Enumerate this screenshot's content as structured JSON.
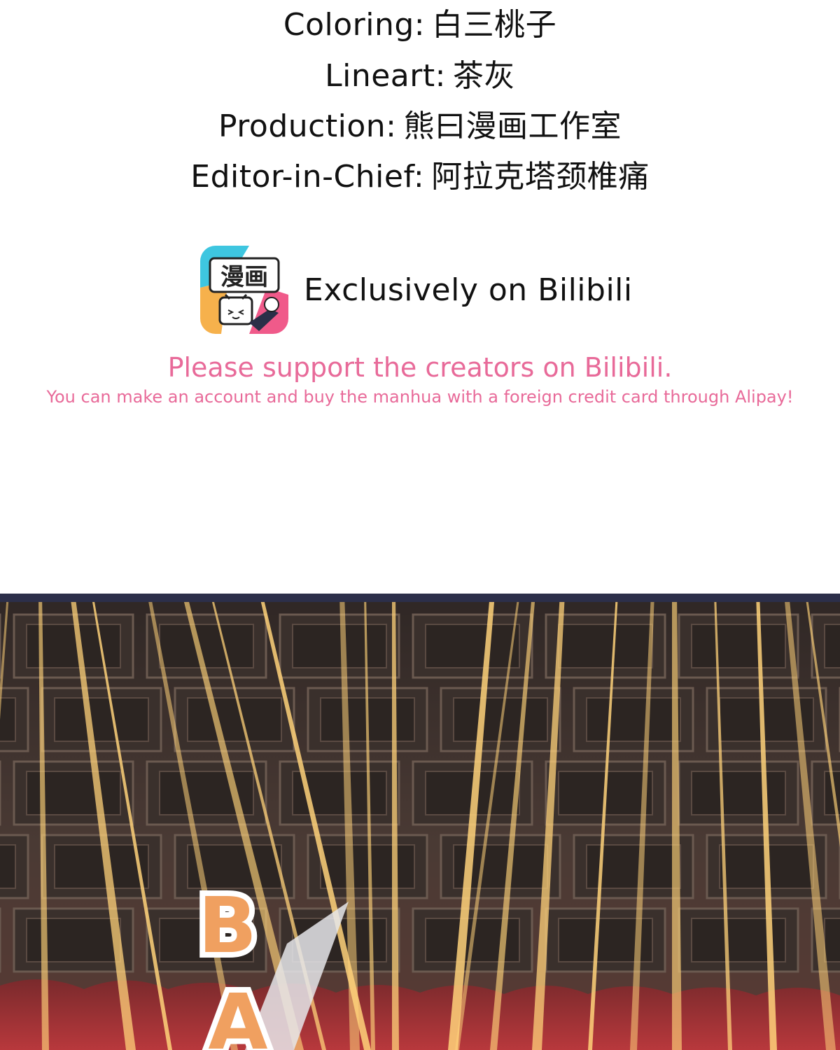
{
  "credits": [
    {
      "label": "Coloring:",
      "value": "白三桃子"
    },
    {
      "label": "Lineart:",
      "value": "茶灰"
    },
    {
      "label": "Production:",
      "value": "熊曰漫画工作室"
    },
    {
      "label": "Editor-in-Chief:",
      "value": "阿拉克塔颈椎痛"
    }
  ],
  "logo": {
    "text": "漫画",
    "icon": "bilibili-manga-app-icon"
  },
  "exclusive": "Exclusively on Bilibili",
  "support": {
    "main": "Please support the creators on Bilibili.",
    "sub": "You can make an account and buy the manhua with a foreign credit card through Alipay!"
  },
  "panel": {
    "sfx": [
      "B",
      "A"
    ],
    "colors": {
      "ceiling": "#4a3a34",
      "speedline": "#ffd27a",
      "curtain": "#b8383c",
      "frame": "#2c2f4a",
      "sfx": "#f0a060"
    }
  }
}
